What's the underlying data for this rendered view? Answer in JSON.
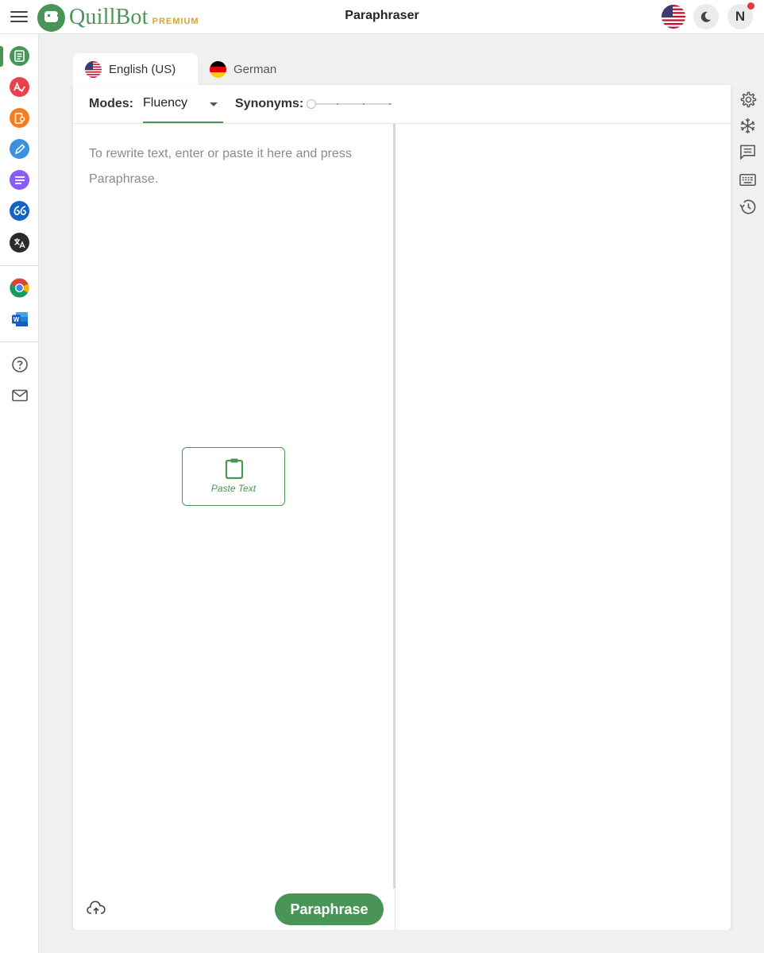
{
  "header": {
    "menu_icon": "hamburger-icon",
    "logo_text": "QuillBot",
    "logo_badge": "PREMIUM",
    "page_title": "Paraphraser",
    "language_flag": "us-flag-icon",
    "theme_icon": "moon-icon",
    "avatar_initial": "N",
    "notification_color": "#e53935"
  },
  "sidebar": {
    "tools": [
      {
        "name": "paraphraser",
        "icon": "paraphraser-icon",
        "color": "#499557",
        "active": true
      },
      {
        "name": "grammar-checker",
        "icon": "grammar-checker-icon",
        "color": "#e8434c"
      },
      {
        "name": "plagiarism-checker",
        "icon": "plagiarism-checker-icon",
        "color": "#f57d1f"
      },
      {
        "name": "co-writer",
        "icon": "co-writer-icon",
        "color": "#3d8fe0"
      },
      {
        "name": "summarizer",
        "icon": "summarizer-icon",
        "color": "#8b5cf6"
      },
      {
        "name": "citation-generator",
        "icon": "citation-icon",
        "color": "#1464c7"
      },
      {
        "name": "translator",
        "icon": "translator-icon",
        "color": "#2b2b2b"
      }
    ],
    "extensions": [
      {
        "name": "chrome-extension",
        "icon": "chrome-icon"
      },
      {
        "name": "word-addin",
        "icon": "word-icon"
      }
    ],
    "support": [
      {
        "name": "help",
        "icon": "help-icon"
      },
      {
        "name": "contact",
        "icon": "mail-icon"
      }
    ]
  },
  "tabs": [
    {
      "label": "English (US)",
      "flag": "us-flag-icon",
      "active": true
    },
    {
      "label": "German",
      "flag": "de-flag-icon",
      "active": false
    }
  ],
  "toolbar": {
    "modes_label": "Modes:",
    "mode_value": "Fluency",
    "synonyms_label": "Synonyms:",
    "synonyms_level": 0
  },
  "editor": {
    "placeholder": "To rewrite text, enter or paste it here and press Paraphrase.",
    "paste_label": "Paste Text",
    "paraphrase_label": "Paraphrase",
    "upload_icon": "cloud-upload-icon"
  },
  "right_tools": [
    {
      "name": "settings",
      "icon": "gear-icon"
    },
    {
      "name": "freeze-words",
      "icon": "snowflake-icon"
    },
    {
      "name": "feedback",
      "icon": "comment-icon"
    },
    {
      "name": "keyboard-shortcuts",
      "icon": "keyboard-icon"
    },
    {
      "name": "history",
      "icon": "history-icon"
    }
  ],
  "colors": {
    "accent": "#499557",
    "premium": "#d4a72c"
  }
}
